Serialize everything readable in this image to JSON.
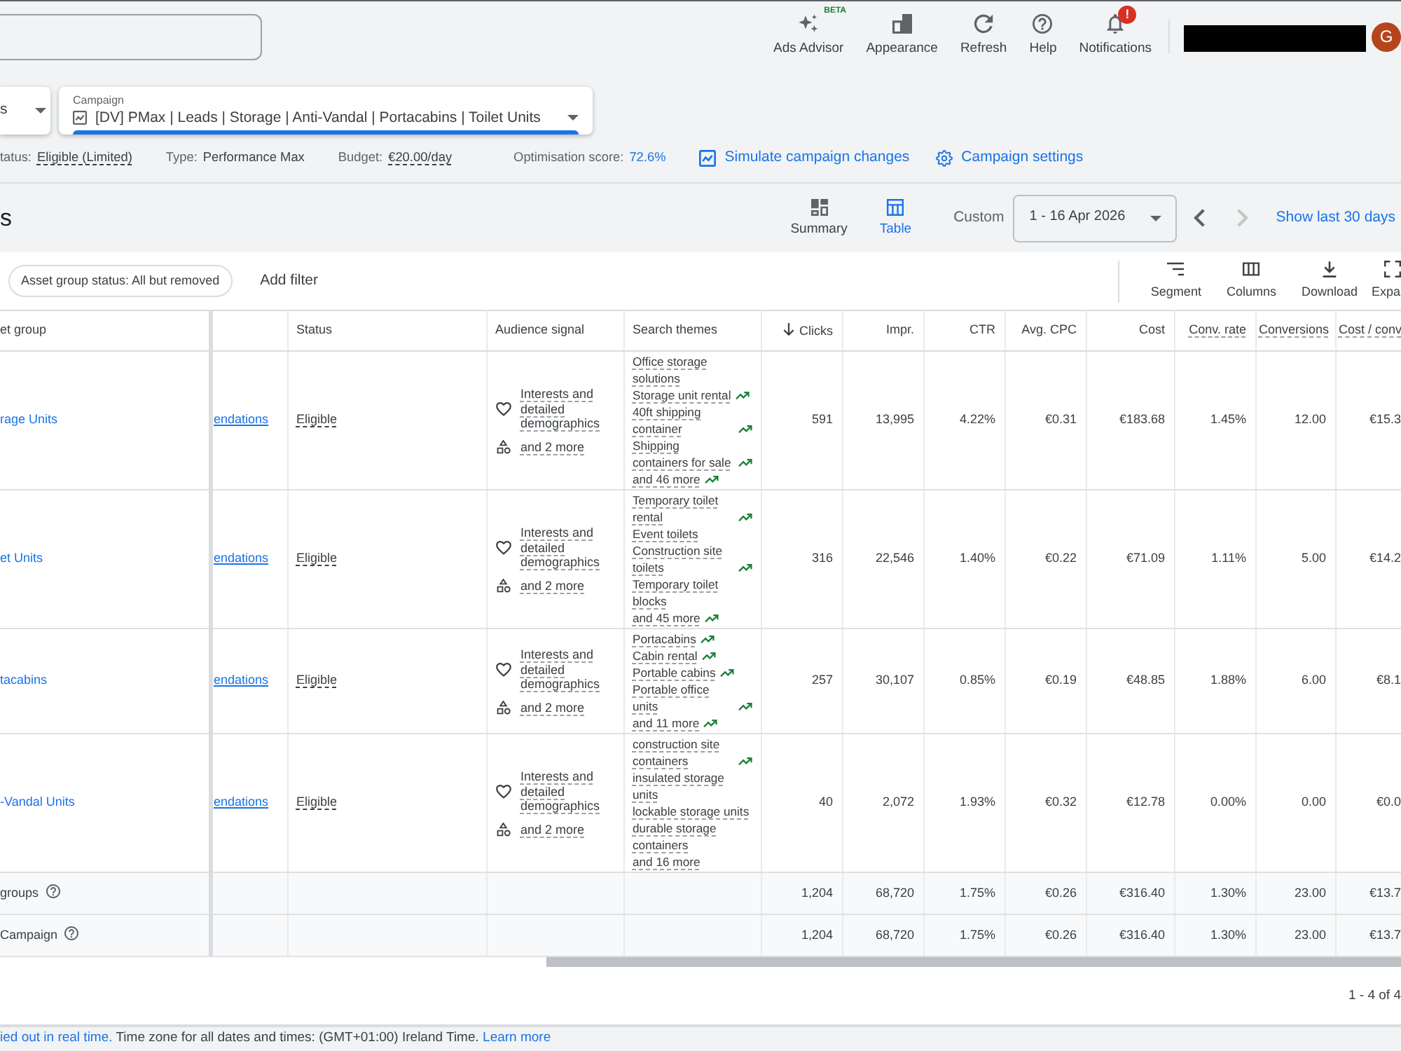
{
  "topbar": {
    "actions": [
      {
        "label": "Ads Advisor",
        "tag": "BETA"
      },
      {
        "label": "Appearance"
      },
      {
        "label": "Refresh"
      },
      {
        "label": "Help"
      },
      {
        "label": "Notifications",
        "alert": "!"
      }
    ],
    "avatar": "G"
  },
  "selectors": [
    {
      "value": "s",
      "focused": false
    },
    {
      "label": "Campaign",
      "value": "[DV] PMax | Leads | Storage | Anti-Vandal | Portacabins | Toilet Units",
      "focused": true
    }
  ],
  "campaign_info": [
    {
      "label": "tatus:",
      "value": "Eligible (Limited)",
      "kind": "dotted"
    },
    {
      "label": "Type:",
      "value": "Performance Max",
      "kind": "plain"
    },
    {
      "label": "Budget:",
      "value": "€20.00/day",
      "kind": "dotted"
    },
    {
      "label": "Optimisation score:",
      "value": "72.6%",
      "kind": "link"
    }
  ],
  "campaign_actions": [
    "Simulate campaign changes",
    "Campaign settings"
  ],
  "page_title": "s",
  "view_tabs": [
    {
      "label": "Summary",
      "selected": false
    },
    {
      "label": "Table",
      "selected": true
    }
  ],
  "date_range": {
    "label": "Custom",
    "value": "1 - 16 Apr 2026",
    "previous_disabled": false,
    "next_disabled": true,
    "shortcut": "Show last 30 days"
  },
  "filters": {
    "chips": [
      "Asset group status: All but removed"
    ],
    "add_label": "Add filter"
  },
  "table_tools": [
    "Segment",
    "Columns",
    "Download",
    "Expa"
  ],
  "table": {
    "columns": [
      "et group",
      "Status",
      "Audience signal",
      "Search themes"
    ],
    "metric_columns": [
      {
        "label": "Clicks",
        "sorted": true,
        "has_definition": false
      },
      {
        "label": "Impr.",
        "sorted": false,
        "has_definition": false
      },
      {
        "label": "CTR",
        "sorted": false,
        "has_definition": false
      },
      {
        "label": "Avg. CPC",
        "sorted": false,
        "has_definition": false
      },
      {
        "label": "Cost",
        "sorted": false,
        "has_definition": false
      },
      {
        "label": "Conv. rate",
        "sorted": false,
        "has_definition": true
      },
      {
        "label": "Conversions",
        "sorted": false,
        "has_definition": true
      },
      {
        "label": "Cost / conv",
        "sorted": false,
        "has_definition": true
      }
    ],
    "rows": [
      {
        "name": "rage Units",
        "recommendations": "endations",
        "status": "Eligible",
        "audience": [
          "Interests and detailed demographics",
          "and 2 more"
        ],
        "themes": [
          {
            "text": "Office storage solutions",
            "trending": false
          },
          {
            "text": "Storage unit rental",
            "trending": true
          },
          {
            "text": "40ft shipping container",
            "trending": true
          },
          {
            "text": "Shipping containers for sale",
            "trending": true
          },
          {
            "text": "and 46 more",
            "trending": true
          }
        ],
        "metrics": [
          "591",
          "13,995",
          "4.22%",
          "€0.31",
          "€183.68",
          "1.45%",
          "12.00",
          "€15.3"
        ]
      },
      {
        "name": "et Units",
        "recommendations": "endations",
        "status": "Eligible",
        "audience": [
          "Interests and detailed demographics",
          "and 2 more"
        ],
        "themes": [
          {
            "text": "Temporary toilet rental",
            "trending": true
          },
          {
            "text": "Event toilets",
            "trending": false
          },
          {
            "text": "Construction site toilets",
            "trending": true
          },
          {
            "text": "Temporary toilet blocks",
            "trending": false
          },
          {
            "text": "and 45 more",
            "trending": true
          }
        ],
        "metrics": [
          "316",
          "22,546",
          "1.40%",
          "€0.22",
          "€71.09",
          "1.11%",
          "5.00",
          "€14.2"
        ]
      },
      {
        "name": "tacabins",
        "recommendations": "endations",
        "status": "Eligible",
        "audience": [
          "Interests and detailed demographics",
          "and 2 more"
        ],
        "themes": [
          {
            "text": "Portacabins",
            "trending": true
          },
          {
            "text": "Cabin rental",
            "trending": true
          },
          {
            "text": "Portable cabins",
            "trending": true
          },
          {
            "text": "Portable office units",
            "trending": true
          },
          {
            "text": "and 11 more",
            "trending": true
          }
        ],
        "metrics": [
          "257",
          "30,107",
          "0.85%",
          "€0.19",
          "€48.85",
          "1.88%",
          "6.00",
          "€8.1"
        ]
      },
      {
        "name": "-Vandal Units",
        "recommendations": "endations",
        "status": "Eligible",
        "audience": [
          "Interests and detailed demographics",
          "and 2 more"
        ],
        "themes": [
          {
            "text": "construction site containers",
            "trending": true
          },
          {
            "text": "insulated storage units",
            "trending": false
          },
          {
            "text": "lockable storage units",
            "trending": false
          },
          {
            "text": "durable storage containers",
            "trending": false
          },
          {
            "text": "and 16 more",
            "trending": false
          }
        ],
        "metrics": [
          "40",
          "2,072",
          "1.93%",
          "€0.32",
          "€12.78",
          "0.00%",
          "0.00",
          "€0.0"
        ]
      }
    ],
    "totals": [
      {
        "label": "groups",
        "metrics": [
          "1,204",
          "68,720",
          "1.75%",
          "€0.26",
          "€316.40",
          "1.30%",
          "23.00",
          "€13.7"
        ]
      },
      {
        "label": "Campaign",
        "metrics": [
          "1,204",
          "68,720",
          "1.75%",
          "€0.26",
          "€316.40",
          "1.30%",
          "23.00",
          "€13.7"
        ]
      }
    ]
  },
  "pagination": "1 - 4 of 4",
  "footer": [
    {
      "text": "ied out in real time.",
      "link": true
    },
    {
      "text": "Time zone for all dates and times: (GMT+01:00) Ireland Time.",
      "link": false
    },
    {
      "text": "Learn more",
      "link": true
    }
  ]
}
